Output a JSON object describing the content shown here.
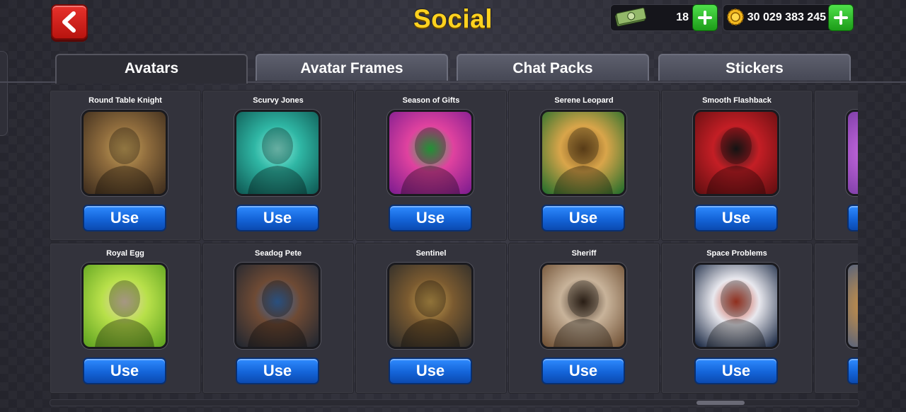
{
  "header": {
    "title": "Social",
    "cash": {
      "value": "18",
      "icon": "cash-icon"
    },
    "coins": {
      "value": "30 029 383 245",
      "icon": "coin-icon"
    }
  },
  "tabs": [
    {
      "label": "Avatars",
      "active": true
    },
    {
      "label": "Avatar Frames",
      "active": false
    },
    {
      "label": "Chat Packs",
      "active": false
    },
    {
      "label": "Stickers",
      "active": false
    }
  ],
  "avatars": [
    {
      "name": "Round Table Knight",
      "button": "Use",
      "colors": [
        "#3a2a1c",
        "#8f6c3d",
        "#c9a45b"
      ]
    },
    {
      "name": "Scurvy Jones",
      "button": "Use",
      "colors": [
        "#0d5550",
        "#2fb6a4",
        "#8ff3e1"
      ]
    },
    {
      "name": "Season of Gifts",
      "button": "Use",
      "colors": [
        "#7a1b8f",
        "#e0429f",
        "#2ecb4a"
      ]
    },
    {
      "name": "Serene Leopard",
      "button": "Use",
      "colors": [
        "#1c6b2a",
        "#d9a54a",
        "#7a5320"
      ]
    },
    {
      "name": "Smooth Flashback",
      "button": "Use",
      "colors": [
        "#5e0e10",
        "#c41e25",
        "#1b1b1b"
      ]
    },
    {
      "name": "Royal Egg",
      "button": "Use",
      "colors": [
        "#5aa01e",
        "#b8e04a",
        "#e7d2b6"
      ]
    },
    {
      "name": "Seadog Pete",
      "button": "Use",
      "colors": [
        "#1e2530",
        "#6e4a34",
        "#3a6fb0"
      ]
    },
    {
      "name": "Sentinel",
      "button": "Use",
      "colors": [
        "#2a2a2a",
        "#7a5a30",
        "#c8a050"
      ]
    },
    {
      "name": "Sheriff",
      "button": "Use",
      "colors": [
        "#6b4b2f",
        "#c8b39a",
        "#3a2a1e"
      ]
    },
    {
      "name": "Space Problems",
      "button": "Use",
      "colors": [
        "#0f1e3a",
        "#e8e8ee",
        "#c8412a"
      ]
    }
  ],
  "partial_avatars": [
    {
      "colors": [
        "#5a2a8a",
        "#d06ee8"
      ]
    },
    {
      "colors": [
        "#1a4a9a",
        "#e09a3a"
      ]
    }
  ]
}
